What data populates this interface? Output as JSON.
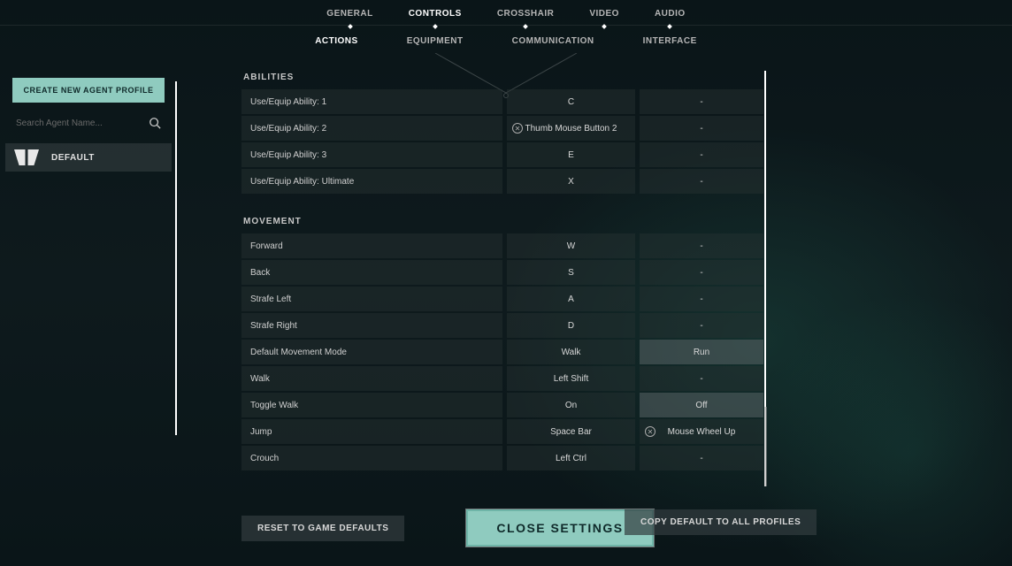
{
  "topnav": {
    "items": [
      "GENERAL",
      "CONTROLS",
      "CROSSHAIR",
      "VIDEO",
      "AUDIO"
    ],
    "active": "CONTROLS"
  },
  "subnav": {
    "items": [
      "ACTIONS",
      "EQUIPMENT",
      "COMMUNICATION",
      "INTERFACE"
    ],
    "active": "ACTIONS"
  },
  "sidebar": {
    "create_label": "CREATE NEW AGENT PROFILE",
    "search_placeholder": "Search Agent Name...",
    "profile_label": "DEFAULT"
  },
  "sections": [
    {
      "title": "ABILITIES",
      "rows": [
        {
          "label": "Use/Equip Ability: 1",
          "primary": "C",
          "secondary": "-",
          "clear_p": false,
          "clear_s": false
        },
        {
          "label": "Use/Equip Ability: 2",
          "primary": "Thumb Mouse Button 2",
          "secondary": "-",
          "clear_p": true,
          "clear_s": false
        },
        {
          "label": "Use/Equip Ability: 3",
          "primary": "E",
          "secondary": "-",
          "clear_p": false,
          "clear_s": false
        },
        {
          "label": "Use/Equip Ability: Ultimate",
          "primary": "X",
          "secondary": "-",
          "clear_p": false,
          "clear_s": false
        }
      ]
    },
    {
      "title": "MOVEMENT",
      "rows": [
        {
          "label": "Forward",
          "primary": "W",
          "secondary": "-",
          "clear_p": false,
          "clear_s": false
        },
        {
          "label": "Back",
          "primary": "S",
          "secondary": "-",
          "clear_p": false,
          "clear_s": false
        },
        {
          "label": "Strafe Left",
          "primary": "A",
          "secondary": "-",
          "clear_p": false,
          "clear_s": false
        },
        {
          "label": "Strafe Right",
          "primary": "D",
          "secondary": "-",
          "clear_p": false,
          "clear_s": false
        },
        {
          "label": "Default Movement Mode",
          "primary": "Walk",
          "secondary": "Run",
          "clear_p": false,
          "clear_s": false,
          "toggle_secondary": true
        },
        {
          "label": "Walk",
          "primary": "Left Shift",
          "secondary": "-",
          "clear_p": false,
          "clear_s": false
        },
        {
          "label": "Toggle Walk",
          "primary": "On",
          "secondary": "Off",
          "clear_p": false,
          "clear_s": false,
          "toggle_secondary": true
        },
        {
          "label": "Jump",
          "primary": "Space Bar",
          "secondary": "Mouse Wheel Up",
          "clear_p": false,
          "clear_s": true
        },
        {
          "label": "Crouch",
          "primary": "Left Ctrl",
          "secondary": "-",
          "clear_p": false,
          "clear_s": false
        }
      ]
    }
  ],
  "bottom": {
    "reset": "RESET TO GAME DEFAULTS",
    "close": "CLOSE SETTINGS",
    "copy": "COPY DEFAULT TO ALL PROFILES"
  }
}
